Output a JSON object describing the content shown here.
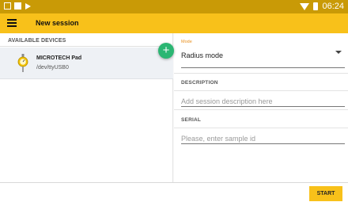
{
  "statusbar": {
    "time": "06:24",
    "icons": [
      "image-icon",
      "square-icon",
      "play-store-icon",
      "wifi-icon",
      "battery-icon"
    ]
  },
  "appbar": {
    "title": "New session",
    "menu_icon": "hamburger-menu-icon",
    "color": "#f8c11a"
  },
  "devices": {
    "header": "AVAILABLE DEVICES",
    "items": [
      {
        "name": "MICROTECH Pad",
        "path": "/dev/ttyUSB0",
        "icon": "caliper-indicator-icon"
      }
    ],
    "add_icon": "plus-icon"
  },
  "form": {
    "mode_label": "Mode",
    "mode_value": "Radius mode",
    "description_header": "DESCRIPTION",
    "description_placeholder": "Add session description here",
    "serial_header": "SERIAL",
    "serial_placeholder": "Please, enter sample id"
  },
  "footer": {
    "start_label": "START"
  },
  "colors": {
    "accent": "#f8c11a",
    "statusbar": "#c99a06",
    "fab": "#2bb673",
    "mode_label": "#e8901f"
  }
}
